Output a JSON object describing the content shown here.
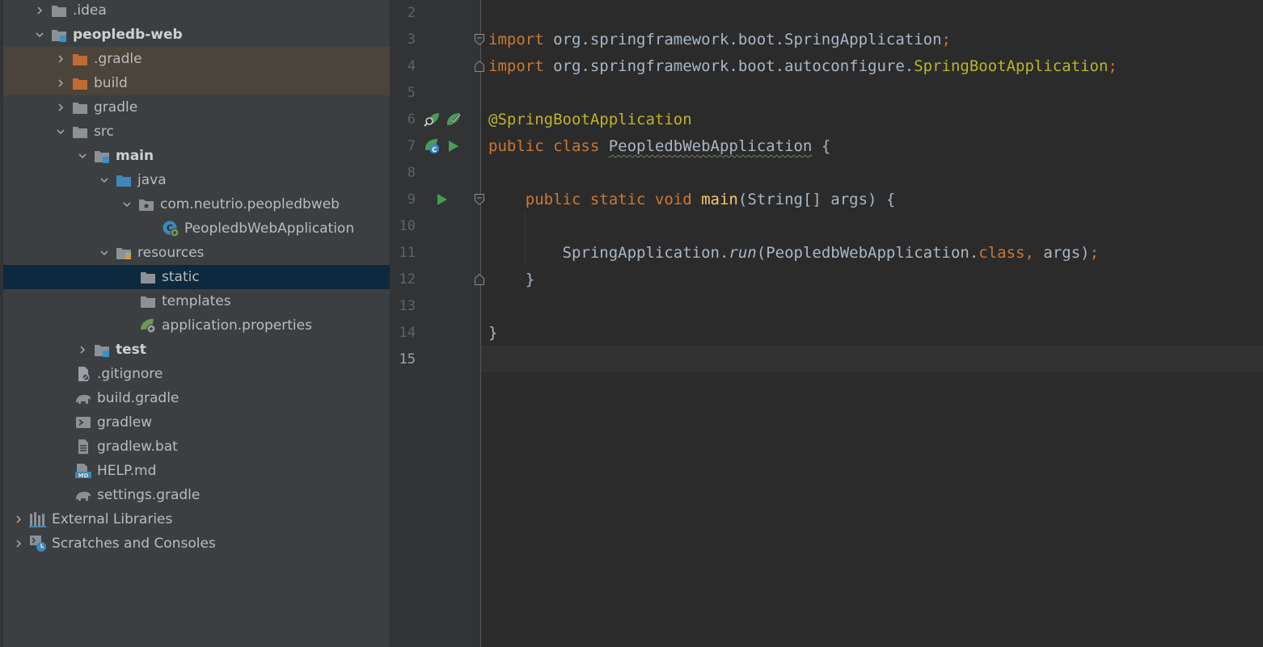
{
  "project_tree": {
    "items": [
      {
        "label": ".idea",
        "icon": "folder-icon",
        "expanded": false
      },
      {
        "label": "peopledb-web",
        "icon": "module-folder-icon",
        "expanded": true
      },
      {
        "label": ".gradle",
        "icon": "excluded-folder-icon",
        "expanded": false
      },
      {
        "label": "build",
        "icon": "excluded-folder-icon",
        "expanded": false
      },
      {
        "label": "gradle",
        "icon": "folder-icon",
        "expanded": false
      },
      {
        "label": "src",
        "icon": "folder-icon",
        "expanded": true
      },
      {
        "label": "main",
        "icon": "source-set-folder-icon",
        "expanded": true
      },
      {
        "label": "java",
        "icon": "source-root-folder-icon",
        "expanded": true
      },
      {
        "label": "com.neutrio.peopledbweb",
        "icon": "package-icon",
        "expanded": true
      },
      {
        "label": "PeopledbWebApplication",
        "icon": "spring-boot-class-icon"
      },
      {
        "label": "resources",
        "icon": "resources-folder-icon",
        "expanded": true
      },
      {
        "label": "static",
        "icon": "folder-icon",
        "selected": true
      },
      {
        "label": "templates",
        "icon": "folder-icon"
      },
      {
        "label": "application.properties",
        "icon": "spring-properties-icon"
      },
      {
        "label": "test",
        "icon": "test-folder-icon",
        "expanded": false
      },
      {
        "label": ".gitignore",
        "icon": "gitignore-file-icon"
      },
      {
        "label": "build.gradle",
        "icon": "gradle-elephant-icon"
      },
      {
        "label": "gradlew",
        "icon": "shell-script-icon"
      },
      {
        "label": "gradlew.bat",
        "icon": "text-file-icon"
      },
      {
        "label": "HELP.md",
        "icon": "markdown-file-icon"
      },
      {
        "label": "settings.gradle",
        "icon": "gradle-elephant-icon"
      },
      {
        "label": "External Libraries",
        "icon": "libraries-icon",
        "expanded": false
      },
      {
        "label": "Scratches and Consoles",
        "icon": "scratches-icon",
        "expanded": false
      }
    ]
  },
  "editor": {
    "current_line": "15",
    "lines": [
      {
        "n": "2",
        "tokens": []
      },
      {
        "n": "3",
        "tokens": [
          {
            "t": "import",
            "c": "kw"
          },
          {
            "t": " org.springframework.boot.SpringApplication"
          },
          {
            "t": ";",
            "c": "kw"
          }
        ]
      },
      {
        "n": "4",
        "tokens": [
          {
            "t": "import",
            "c": "kw"
          },
          {
            "t": " org.springframework.boot.autoconfigure."
          },
          {
            "t": "SpringBootApplication",
            "c": "ann"
          },
          {
            "t": ";",
            "c": "kw"
          }
        ]
      },
      {
        "n": "5",
        "tokens": []
      },
      {
        "n": "6",
        "tokens": [
          {
            "t": "@SpringBootApplication",
            "c": "ann"
          }
        ]
      },
      {
        "n": "7",
        "tokens": [
          {
            "t": "public class ",
            "c": "kw"
          },
          {
            "t": "PeopledbWebApplication",
            "c": "squig"
          },
          {
            "t": " {"
          }
        ]
      },
      {
        "n": "8",
        "tokens": []
      },
      {
        "n": "9",
        "tokens": [
          {
            "t": "    "
          },
          {
            "t": "public static void ",
            "c": "kw"
          },
          {
            "t": "main",
            "c": "fn"
          },
          {
            "t": "(String[] args) {"
          }
        ]
      },
      {
        "n": "10",
        "tokens": []
      },
      {
        "n": "11",
        "tokens": [
          {
            "t": "        SpringApplication."
          },
          {
            "t": "run",
            "c": "it"
          },
          {
            "t": "(PeopledbWebApplication."
          },
          {
            "t": "class, ",
            "c": "kw"
          },
          {
            "t": "args)"
          },
          {
            "t": ";",
            "c": "kw"
          }
        ]
      },
      {
        "n": "12",
        "tokens": [
          {
            "t": "    }"
          }
        ]
      },
      {
        "n": "13",
        "tokens": []
      },
      {
        "n": "14",
        "tokens": [
          {
            "t": "}"
          }
        ]
      },
      {
        "n": "15",
        "tokens": []
      }
    ],
    "gutter_icons": [
      {
        "line": "6",
        "icons": [
          "find-beans-icon",
          "spring-bean-icon"
        ]
      },
      {
        "line": "7",
        "icons": [
          "spring-boot-run-icon",
          "run-icon"
        ]
      },
      {
        "line": "9",
        "icons": [
          "run-icon"
        ]
      }
    ],
    "fold_markers": [
      {
        "line": "3",
        "icon": "fold-start-icon"
      },
      {
        "line": "4",
        "icon": "fold-end-icon"
      },
      {
        "line": "9",
        "icon": "fold-start-icon"
      },
      {
        "line": "12",
        "icon": "fold-end-icon"
      }
    ]
  },
  "colors": {
    "editor_bg": "#2b2b2b",
    "tree_bg": "#3c3f41",
    "selection": "#0d293e",
    "excluded_bg": "#4a443a",
    "keyword": "#cc7832",
    "annotation": "#bbb529",
    "method": "#ffc66d",
    "default_text": "#a9b7c6"
  }
}
